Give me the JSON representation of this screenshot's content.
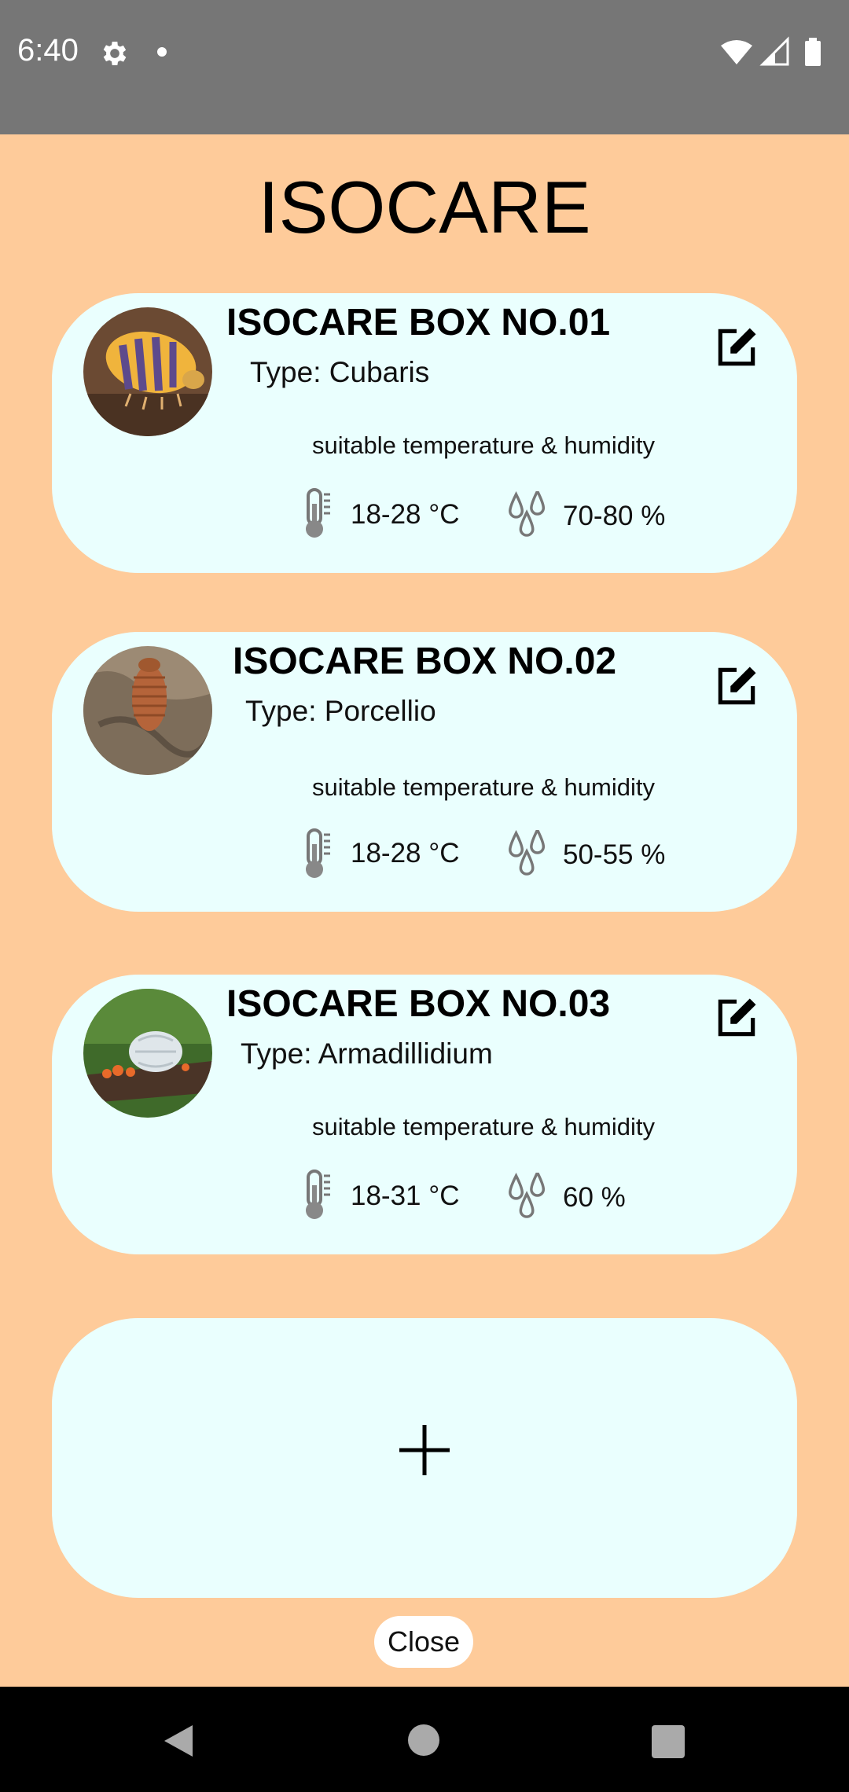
{
  "status_bar": {
    "time": "6:40",
    "icons": [
      "gear-icon",
      "notification-dot-icon",
      "wifi-icon",
      "signal-icon",
      "battery-icon"
    ]
  },
  "app": {
    "title": "ISOCARE"
  },
  "boxes": [
    {
      "name": "ISOCARE BOX NO.01",
      "type": "Type: Cubaris",
      "suitability_label": "suitable temperature & humidity",
      "temperature": "18-28 °C",
      "humidity": "70-80 %",
      "photo_subject": "yellow-and-purple striped isopod"
    },
    {
      "name": "ISOCARE BOX NO.02",
      "type": "Type: Porcellio",
      "suitability_label": "suitable temperature & humidity",
      "temperature": "18-28 °C",
      "humidity": "50-55 %",
      "photo_subject": "orange isopod on bark"
    },
    {
      "name": "ISOCARE BOX NO.03",
      "type": "Type: Armadillidium",
      "suitability_label": "suitable temperature & humidity",
      "temperature": "18-31 °C",
      "humidity": "60 %",
      "photo_subject": "white isopod on branch with orange fungi"
    }
  ],
  "add_box": {
    "icon": "plus-icon"
  },
  "close_button": {
    "label": "Close"
  },
  "nav": {
    "icons": [
      "back-icon",
      "home-icon",
      "recents-icon"
    ]
  },
  "colors": {
    "background": "#fecb9a",
    "card": "#eafffe",
    "status_bar": "#767676",
    "nav_bar": "#000000"
  }
}
